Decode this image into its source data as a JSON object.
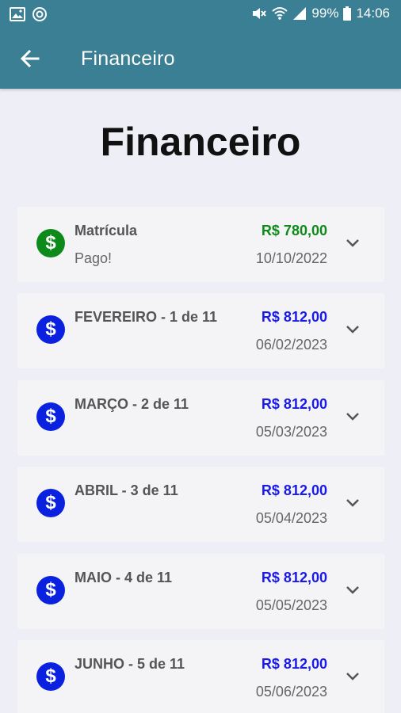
{
  "status_bar": {
    "battery": "99%",
    "time": "14:06"
  },
  "app_bar": {
    "title": "Financeiro"
  },
  "page": {
    "heading": "Financeiro"
  },
  "colors": {
    "app_bar": "#3a7f93",
    "paid": "#0e8a1a",
    "pending": "#1a1ae6"
  },
  "payments": [
    {
      "title": "Matrícula",
      "subtitle": "Pago!",
      "amount": "R$ 780,00",
      "date": "10/10/2022",
      "status": "paid"
    },
    {
      "title": "FEVEREIRO - 1 de 11",
      "subtitle": "",
      "amount": "R$ 812,00",
      "date": "06/02/2023",
      "status": "pending"
    },
    {
      "title": "MARÇO - 2 de 11",
      "subtitle": "",
      "amount": "R$ 812,00",
      "date": "05/03/2023",
      "status": "pending"
    },
    {
      "title": "ABRIL - 3 de 11",
      "subtitle": "",
      "amount": "R$ 812,00",
      "date": "05/04/2023",
      "status": "pending"
    },
    {
      "title": "MAIO - 4 de 11",
      "subtitle": "",
      "amount": "R$ 812,00",
      "date": "05/05/2023",
      "status": "pending"
    },
    {
      "title": "JUNHO - 5 de 11",
      "subtitle": "",
      "amount": "R$ 812,00",
      "date": "05/06/2023",
      "status": "pending"
    }
  ]
}
